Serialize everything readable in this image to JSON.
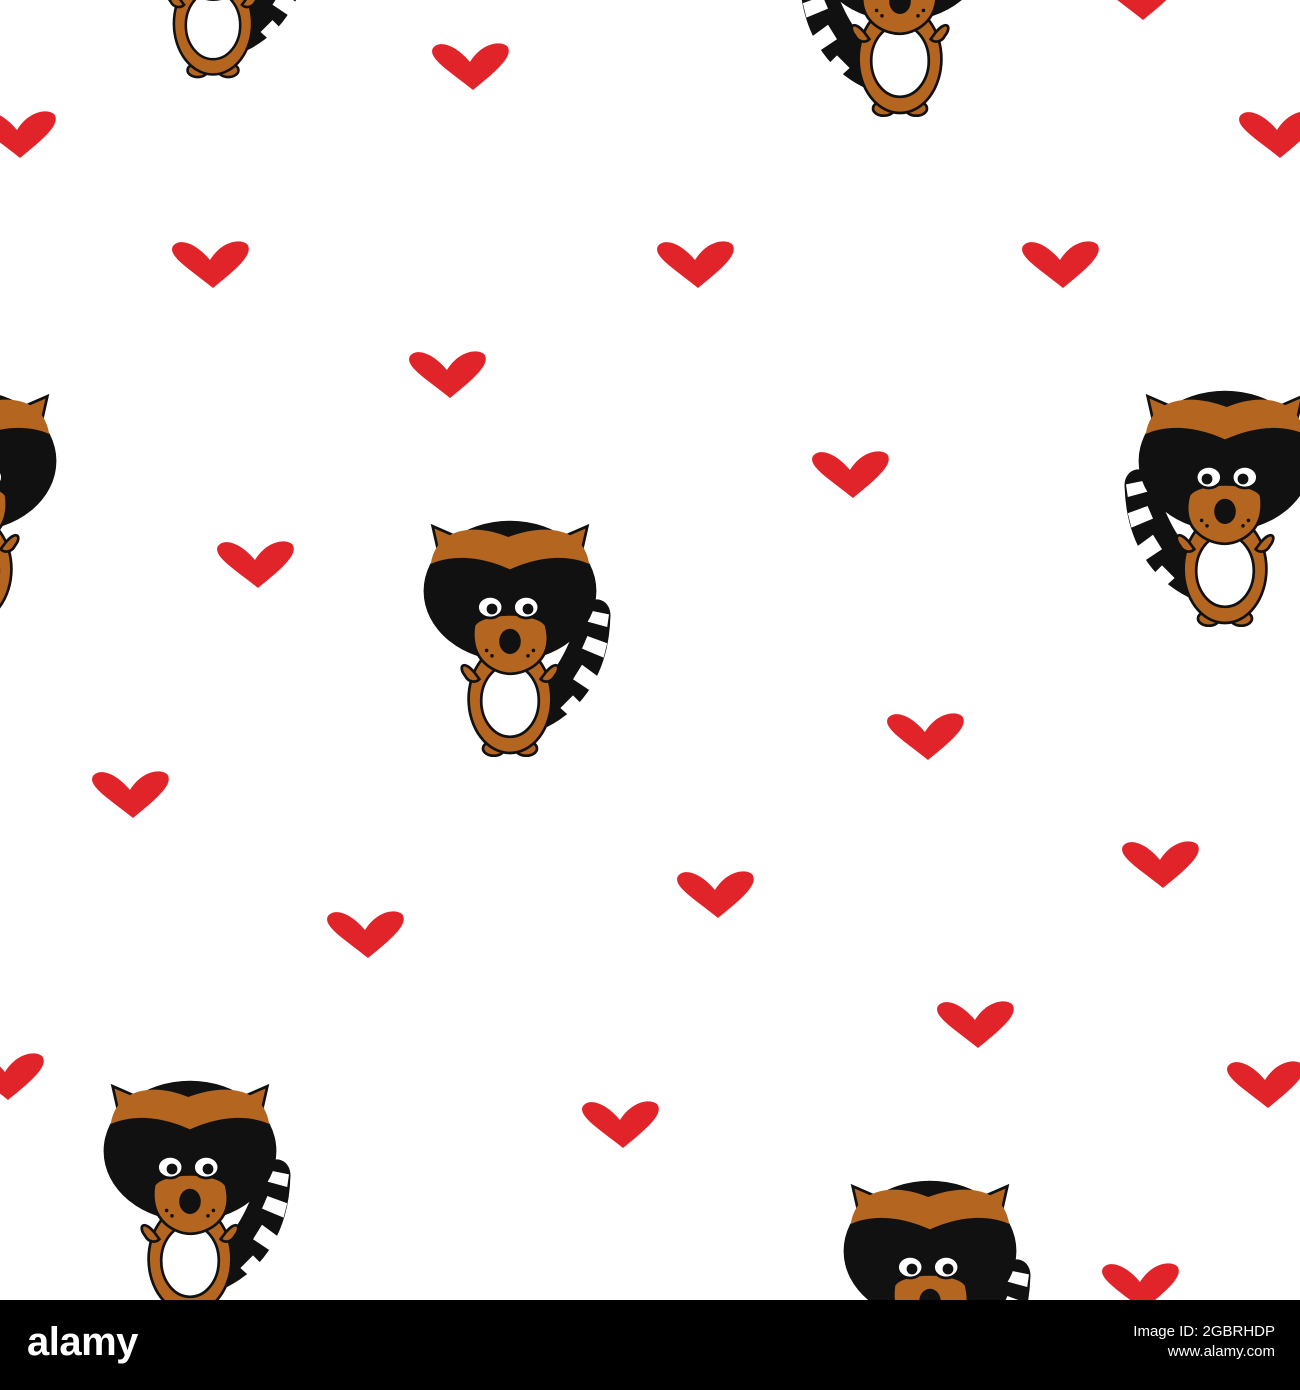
{
  "image": {
    "subject": "raccoon-pattern",
    "colors": {
      "background": "#ffffff",
      "heart": "#e1232a",
      "fur": "#b4651f",
      "mask": "#111111",
      "belly": "#ffffff",
      "outline": "#111111"
    }
  },
  "footer": {
    "brand": "alamy",
    "image_id_line1": "Image ID: 2GBRHDP",
    "image_id_line2": "www.alamy.com",
    "background": "#000000"
  }
}
